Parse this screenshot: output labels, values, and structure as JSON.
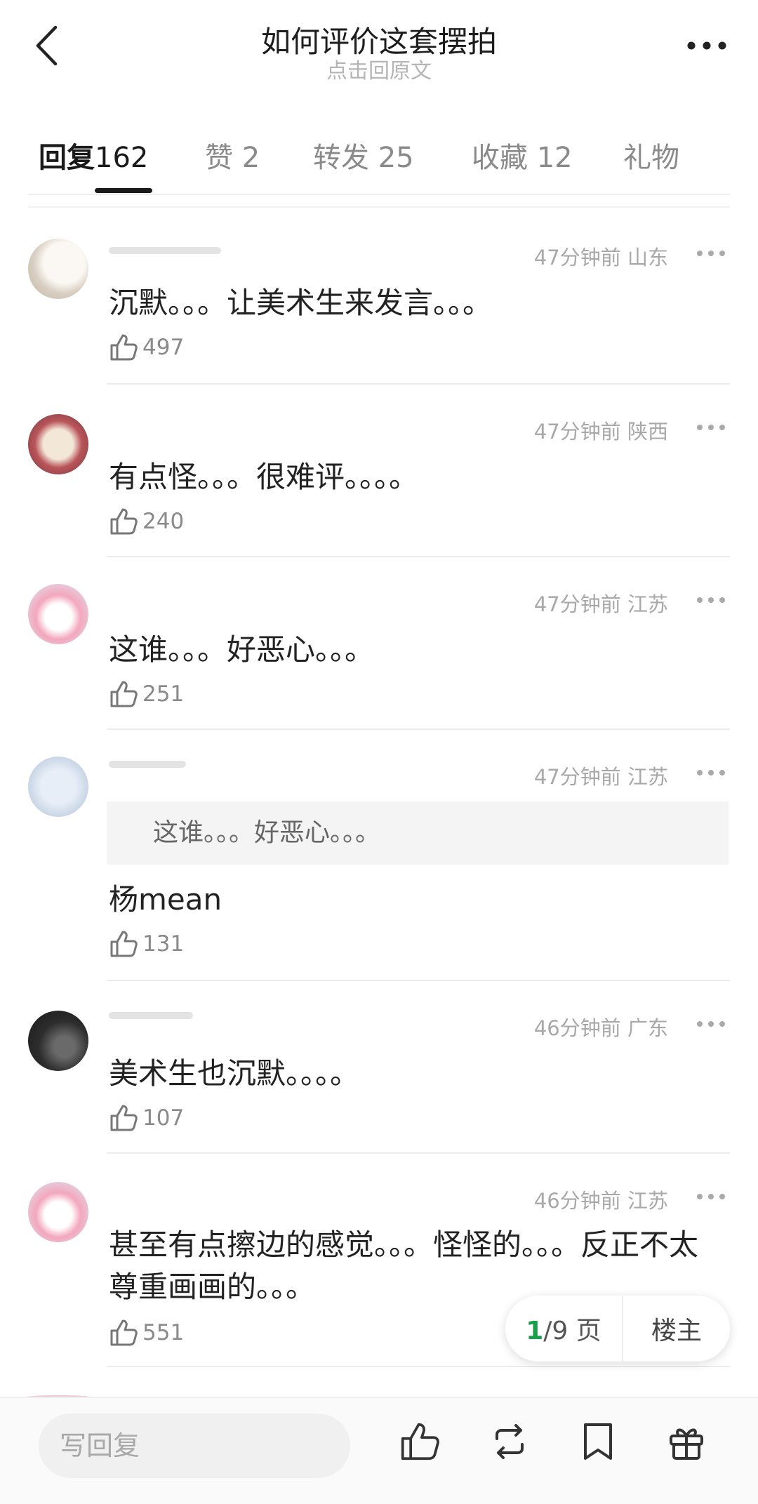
{
  "header": {
    "title": "如何评价这套摆拍",
    "subtitle": "点击回原文"
  },
  "tabs": [
    {
      "label": "回复",
      "count": "162",
      "active": true
    },
    {
      "label": "赞",
      "count": "2"
    },
    {
      "label": "转发",
      "count": "25"
    },
    {
      "label": "收藏",
      "count": "12"
    },
    {
      "label": "礼物",
      "count": ""
    }
  ],
  "comments": [
    {
      "time": "47分钟前",
      "location": "山东",
      "text": "沉默。。。让美术生来发言。。。",
      "likes": "497"
    },
    {
      "time": "47分钟前",
      "location": "陕西",
      "text": "有点怪。。。很难评。。。。",
      "likes": "240"
    },
    {
      "time": "47分钟前",
      "location": "江苏",
      "text": "这谁。。。好恶心。。。",
      "likes": "251"
    },
    {
      "time": "47分钟前",
      "location": "江苏",
      "quote": "这谁。。。好恶心。。。",
      "text": "杨mean",
      "likes": "131"
    },
    {
      "time": "46分钟前",
      "location": "广东",
      "text": "美术生也沉默。。。。",
      "likes": "107"
    },
    {
      "time": "46分钟前",
      "location": "江苏",
      "text": "甚至有点擦边的感觉。。。怪怪的。。。反正不太尊重画画的。。。",
      "likes": "551"
    }
  ],
  "pager": {
    "current": "1",
    "total": "/9",
    "suffix": "页",
    "owner": "楼主"
  },
  "bottom": {
    "reply_placeholder": "写回复"
  },
  "icons": {
    "back": "back-arrow-icon",
    "more": "more-dots-icon",
    "like": "thumb-up-icon",
    "repost": "repost-icon",
    "bookmark": "bookmark-icon",
    "gift": "gift-icon"
  },
  "colors": {
    "accent_green": "#1b9e4b",
    "muted_text": "#a8a8a8"
  }
}
